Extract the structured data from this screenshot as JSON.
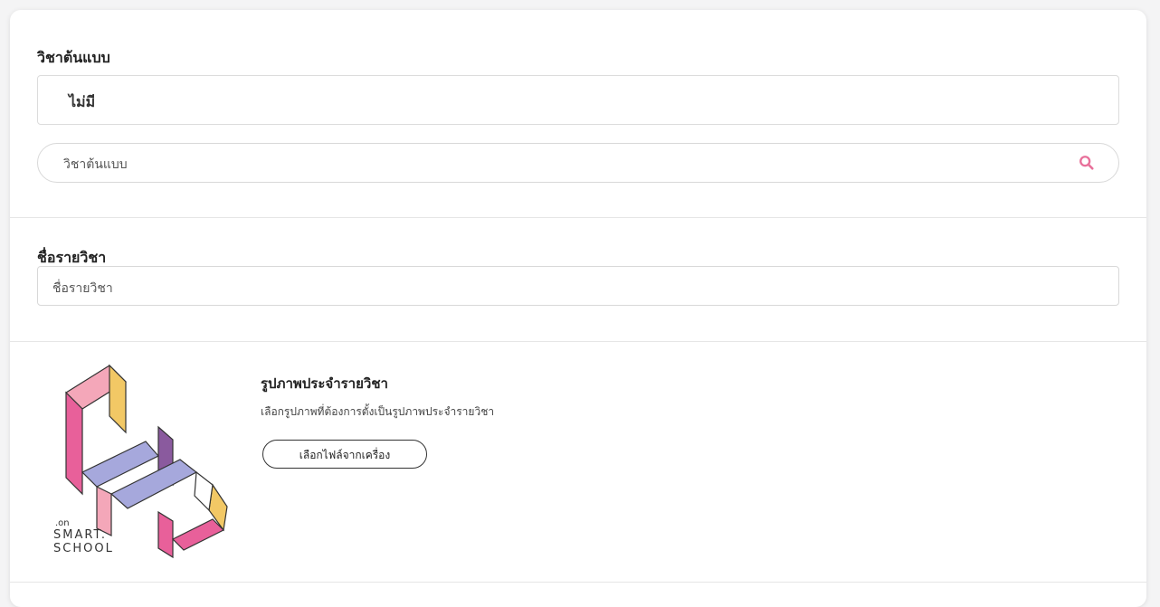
{
  "template_subject": {
    "label": "วิชาต้นแบบ",
    "current_value": "ไม่มี",
    "search_placeholder": "วิชาต้นแบบ",
    "search_icon": "search-icon",
    "search_icon_color": "#e8709a"
  },
  "subject_name": {
    "label": "ชื่อรายวิชา",
    "placeholder": "ชื่อรายวิชา"
  },
  "subject_image": {
    "title": "รูปภาพประจำรายวิชา",
    "description": "เลือกรูปภาพที่ต้องการตั้งเป็นรูปภาพประจำรายวิชา",
    "button_label": "เลือกไฟล์จากเครื่อง",
    "logo": {
      "prefix": ".on",
      "line1": "SMART.",
      "line2": "SCHOOL"
    }
  },
  "colors": {
    "pink": "#e8609a",
    "light_pink": "#f4a7b9",
    "lavender": "#a6a8dc",
    "purple": "#8a5a9e",
    "yellow": "#f2c865"
  }
}
